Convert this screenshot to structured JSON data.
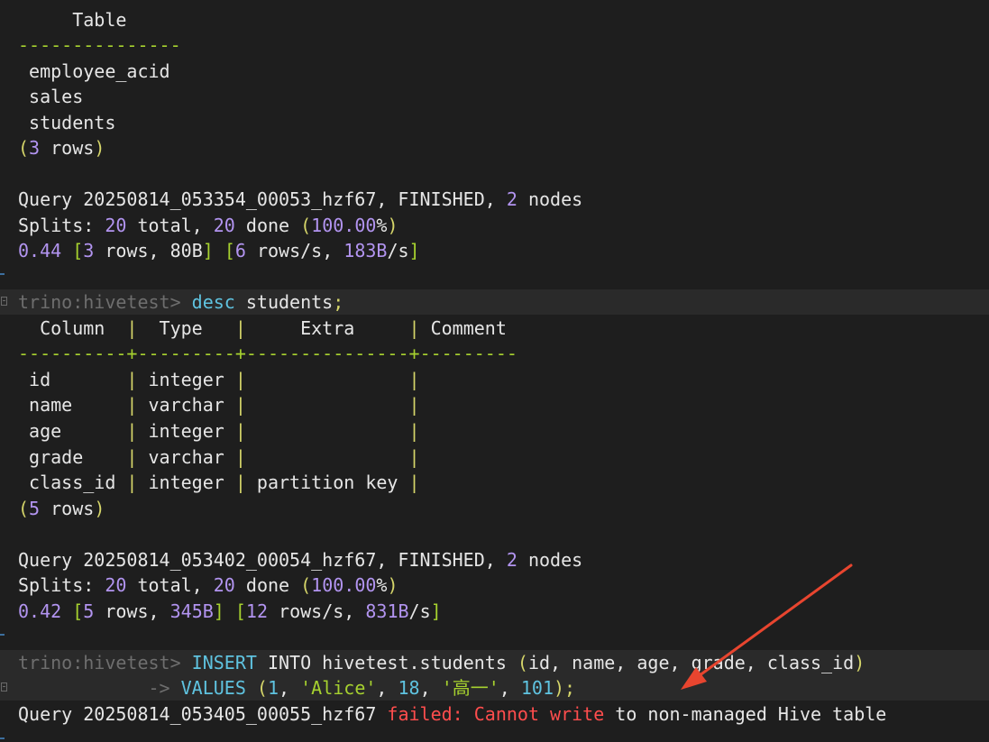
{
  "colors": {
    "background": "#1e1e1e",
    "text": "#e6e6e6",
    "green": "#a6d12f",
    "purple": "#b294f0",
    "cyan": "#5fc3e0",
    "yellow": "#d6d66a",
    "error_red": "#ff4d4d",
    "prompt_dim": "#6e6e6e",
    "annotation_arrow": "#e8452f"
  },
  "block1": {
    "header": "     Table",
    "sep": "---------------",
    "rows": [
      " employee_acid",
      " sales",
      " students"
    ],
    "count_open": "(",
    "count_num": "3",
    "count_rest": " rows",
    "count_close": ")",
    "query_a": "Query 20250814_053354_00053_hzf67, FINISHED, ",
    "query_nodes": "2",
    "query_b": " nodes",
    "splits_label": "Splits",
    "splits_colon": ": ",
    "splits_total": "20",
    "splits_total_label": " total, ",
    "splits_done": "20",
    "splits_done_label": " done ",
    "splits_paren_open": "(",
    "splits_pct": "100.00",
    "splits_pct_sign": "%",
    "splits_paren_close": ")",
    "stats_time": "0.44",
    "stats_b1": " [",
    "stats_rows": "3",
    "stats_rows_label": " rows, ",
    "stats_bytes": "80B",
    "stats_b2": "] [",
    "stats_rps": "6",
    "stats_rps_label": " rows/s, ",
    "stats_bps": "183B",
    "stats_bps_label": "/s",
    "stats_b3": "]"
  },
  "block2": {
    "prompt": "trino:hivetest> ",
    "cmd_kw": "desc",
    "cmd_arg": " students",
    "cmd_semi": ";",
    "header_a": "  Column  ",
    "pipe": "|",
    "header_b": "  Type   ",
    "header_c": "     Extra     ",
    "header_d": " Comment",
    "sep_a": "----------",
    "plus": "+",
    "sep_b": "---------",
    "sep_c": "---------------",
    "sep_d": "---------",
    "rows": [
      {
        "col": " id       ",
        "type": " integer ",
        "extra": "               "
      },
      {
        "col": " name     ",
        "type": " varchar ",
        "extra": "               "
      },
      {
        "col": " age      ",
        "type": " integer ",
        "extra": "               "
      },
      {
        "col": " grade    ",
        "type": " varchar ",
        "extra": "               "
      },
      {
        "col": " class_id ",
        "type": " integer ",
        "extra": " partition key "
      }
    ],
    "count_open": "(",
    "count_num": "5",
    "count_rest": " rows",
    "count_close": ")",
    "query_a": "Query 20250814_053402_00054_hzf67, FINISHED, ",
    "query_nodes": "2",
    "query_b": " nodes",
    "splits_label": "Splits",
    "splits_colon": ": ",
    "splits_total": "20",
    "splits_total_label": " total, ",
    "splits_done": "20",
    "splits_done_label": " done ",
    "splits_paren_open": "(",
    "splits_pct": "100.00",
    "splits_pct_sign": "%",
    "splits_paren_close": ")",
    "stats_time": "0.42",
    "stats_b1": " [",
    "stats_rows": "5",
    "stats_rows_label": " rows, ",
    "stats_bytes": "345B",
    "stats_b2": "] [",
    "stats_rps": "12",
    "stats_rps_label": " rows/s, ",
    "stats_bps": "831B",
    "stats_bps_label": "/s",
    "stats_b3": "]"
  },
  "block3": {
    "prompt": "trino:hivetest> ",
    "kw_insert": "INSERT",
    "kw_into": " INTO ",
    "table": "hivetest.students ",
    "paren_open": "(",
    "cols": "id, name, age, grade, class_id",
    "paren_close": ")",
    "cont_prompt": "            -> ",
    "kw_values": "VALUES",
    "v_space": " ",
    "v_open": "(",
    "v1": "1",
    "v_c1": ", ",
    "v2": "'Alice'",
    "v_c2": ", ",
    "v3": "18",
    "v_c3": ", ",
    "v4": "'高一'",
    "v_c4": ", ",
    "v5": "101",
    "v_close": ")",
    "v_semi": ";",
    "err_query": "Query 20250814_053405_00055_hzf67 ",
    "err_failed": "failed:",
    "err_sp": " ",
    "err_msg": "Cannot write",
    "err_rest": " to non-managed Hive table"
  }
}
